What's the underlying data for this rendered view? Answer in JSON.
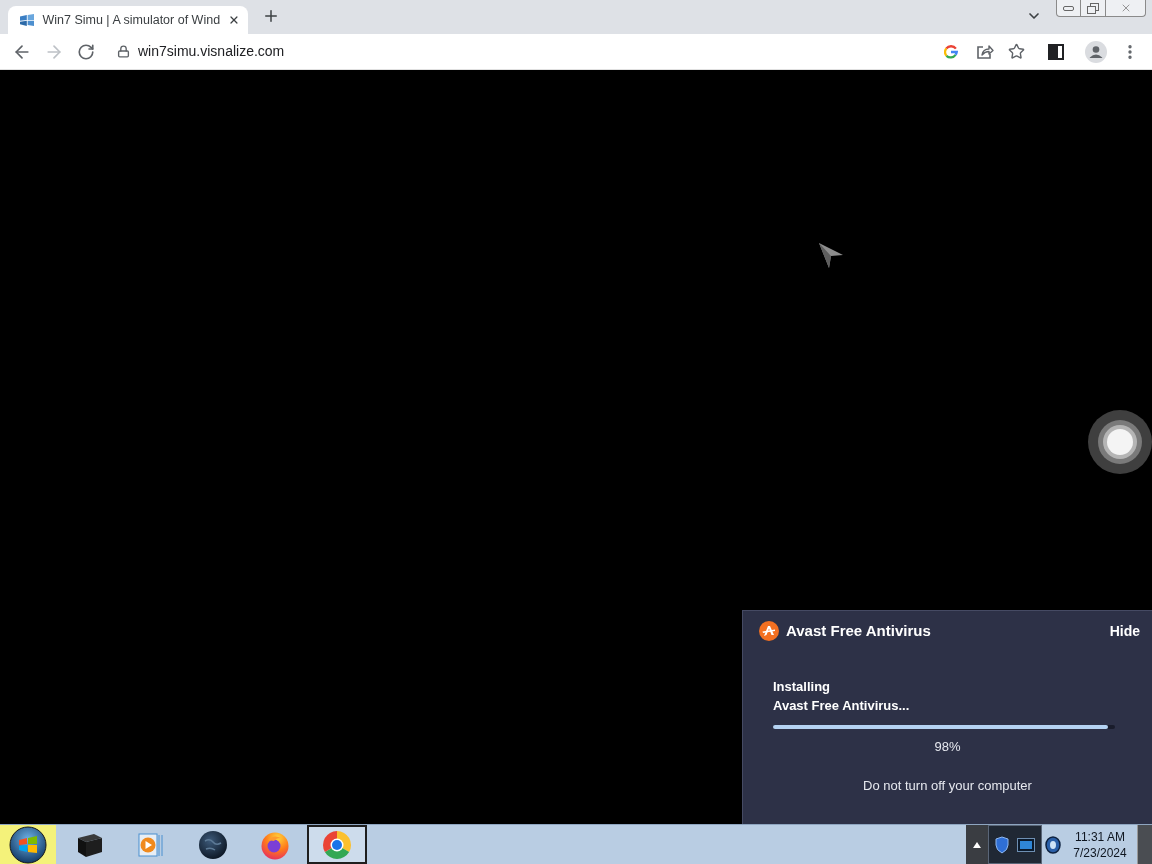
{
  "browser": {
    "tabs": [
      {
        "title": "Win7 Simu | A simulator of Wind",
        "selected": true
      }
    ],
    "toolbar": {
      "back": {
        "disabled": false
      },
      "forward": {
        "disabled": true
      },
      "address": "win7simu.visnalize.com"
    }
  },
  "desktop": {
    "popup": {
      "title": "Avast Free Antivirus",
      "hide": "Hide",
      "status_lines": [
        "Installing",
        "Avast Free Antivirus..."
      ],
      "progress": {
        "level": 0.98,
        "reading": "98%"
      },
      "note": "Do not turn off your computer"
    }
  },
  "taskbar": {
    "start": {
      "hovered": true
    },
    "apps": [
      {
        "kind": "box",
        "selected": false
      },
      {
        "kind": "player",
        "selected": false
      },
      {
        "kind": "globe",
        "selected": false
      },
      {
        "kind": "firefox",
        "selected": false
      },
      {
        "kind": "chrome",
        "selected": true
      }
    ],
    "clock": {
      "time": "11:31 AM",
      "date": "7/23/2024"
    }
  }
}
